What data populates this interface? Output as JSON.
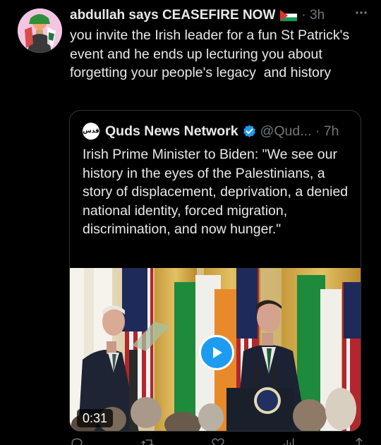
{
  "tweet": {
    "display_name": "abdullah says CEASEFIRE NOW",
    "flag_icon": "palestine-flag-icon",
    "time": "· 3h",
    "more_icon": "more-icon",
    "text": "you invite the Irish leader for a fun St Patrick's event and he ends up lecturing you about forgetting your people's legacy  and history"
  },
  "quote": {
    "name": "Quds News Network",
    "verified_icon": "verified-badge-icon",
    "handle": "@Qud... · 7h",
    "avatar_text": "قدس",
    "text": "Irish Prime Minister to Biden: \"We see our history in the eyes of the Palestinians, a story of displacement, deprivation, a denied national identity, forced migration, discrimination, and now hunger.\"",
    "video": {
      "duration": "0:31",
      "play_icon": "play-icon"
    }
  },
  "actions": [
    {
      "icon": "reply-icon"
    },
    {
      "icon": "retweet-icon"
    },
    {
      "icon": "like-icon"
    },
    {
      "icon": "views-icon"
    },
    {
      "icon": "share-icon"
    }
  ],
  "colors": {
    "background": "#000000",
    "text": "#e7e9ea",
    "muted": "#71767b",
    "accent": "#1d9bf0",
    "border": "#2f3336"
  }
}
